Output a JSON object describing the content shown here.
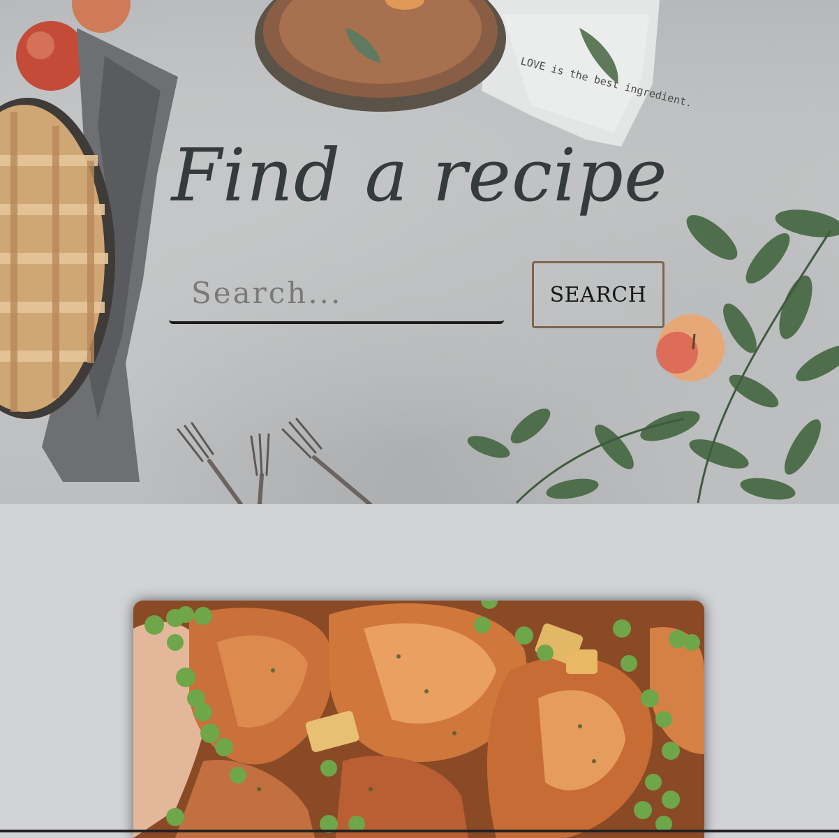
{
  "hero": {
    "title": "Find a recipe",
    "napkin_text": "LOVE is the best ingredient."
  },
  "search": {
    "placeholder": "Search...",
    "value": "",
    "button_label": "SEARCH"
  },
  "colors": {
    "title": "#353b3c",
    "button_border": "#7d6650",
    "page_background": "#d2d3d6"
  },
  "recipe_card": {
    "image_icon": "roast-chicken-photo"
  }
}
